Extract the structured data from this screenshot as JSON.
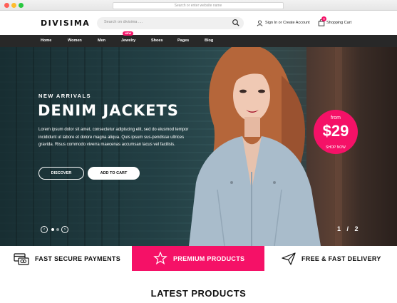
{
  "browser": {
    "url_placeholder": "Search or enter website name"
  },
  "header": {
    "logo": "DIVISIMA",
    "search_placeholder": "Search on divisima ....",
    "account_label": "Sign In or Create Account",
    "cart_label": "Shopping Cart",
    "cart_count": "0"
  },
  "nav": {
    "items": [
      "Home",
      "Women",
      "Men",
      "Jewelry",
      "Shoes",
      "Pages",
      "Blog"
    ],
    "new_badge": "NEW"
  },
  "hero": {
    "subtitle": "NEW ARRIVALS",
    "title": "DENIM JACKETS",
    "description": "Lorem ipsum dolor sit amet, consectetur adipiscing elit, sed do eiusmod tempor incididunt ut labore et dolore magna aliqua. Quis ipsum sus-pendisse ultrices gravida. Risus commodo viverra maecenas accumsan lacus vel facilisis.",
    "discover_label": "DISCOVER",
    "add_to_cart_label": "ADD TO CART",
    "price_from": "from",
    "price_value": "$29",
    "price_shop": "SHOP NOW",
    "pager": "1 / 2",
    "active_slide": 1,
    "slide_count": 2
  },
  "features": [
    {
      "label": "FAST SECURE PAYMENTS",
      "icon": "card-payment-icon"
    },
    {
      "label": "PREMIUM PRODUCTS",
      "icon": "star-badge-icon"
    },
    {
      "label": "FREE & FAST DELIVERY",
      "icon": "paper-plane-icon"
    }
  ],
  "colors": {
    "accent": "#f51167",
    "nav_bg": "#282828"
  },
  "section": {
    "latest_title": "LATEST PRODUCTS"
  }
}
